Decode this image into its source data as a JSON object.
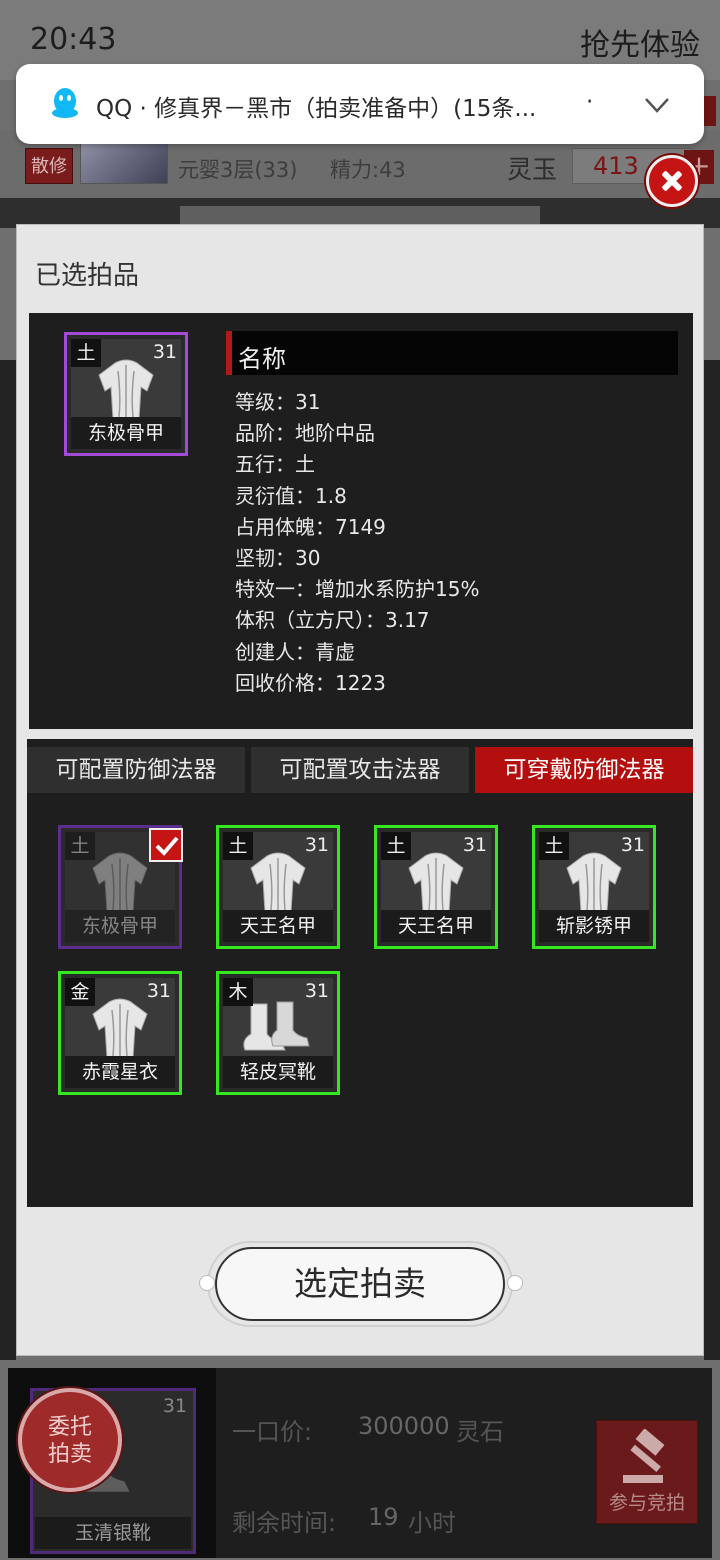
{
  "status_bar": {
    "time": "20:43",
    "right_text": "抢先体验"
  },
  "notification": {
    "app": "QQ",
    "text": "QQ · 修真界－黑市（拍卖准备中）(15条...",
    "dot": "·"
  },
  "background_header": {
    "role": "散修",
    "level": "元婴3层(33)",
    "energy": "精力:43",
    "jade_label": "灵玉",
    "jade_value": "413"
  },
  "modal": {
    "title": "已选拍品",
    "selected_item": {
      "element": "土",
      "level": "31",
      "name": "东极骨甲"
    },
    "name_header": "名称",
    "attributes": [
      "等级：31",
      "品阶：地阶中品",
      "五行：土",
      "灵衍值：1.8",
      "占用体魄：7149",
      "坚韧：30",
      "特效一：增加水系防护15%",
      "体积（立方尺）：3.17",
      "创建人：青虚",
      "回收价格：1223"
    ],
    "tabs": [
      {
        "label": "可配置防御法器",
        "active": false
      },
      {
        "label": "可配置攻击法器",
        "active": false
      },
      {
        "label": "可穿戴防御法器",
        "active": true
      }
    ],
    "items": [
      {
        "element": "土",
        "level": "",
        "name": "东极骨甲",
        "selected": true,
        "icon": "armor-icon"
      },
      {
        "element": "土",
        "level": "31",
        "name": "天王名甲",
        "selected": false,
        "icon": "armor-icon"
      },
      {
        "element": "土",
        "level": "31",
        "name": "天王名甲",
        "selected": false,
        "icon": "armor-icon"
      },
      {
        "element": "土",
        "level": "31",
        "name": "斩影锈甲",
        "selected": false,
        "icon": "armor-icon"
      },
      {
        "element": "金",
        "level": "31",
        "name": "赤霞星衣",
        "selected": false,
        "icon": "armor-icon"
      },
      {
        "element": "木",
        "level": "31",
        "name": "轻皮冥靴",
        "selected": false,
        "icon": "boots-icon"
      }
    ],
    "confirm_label": "选定拍卖"
  },
  "listing": {
    "entrust_label_1": "委托",
    "entrust_label_2": "拍卖",
    "item_level": "31",
    "item_name": "玉清银靴",
    "price_label": "一口价:",
    "price_value": "300000",
    "price_unit": "灵石",
    "time_label": "剩余时间:",
    "time_value": "19",
    "time_unit": "小时",
    "bid_label": "参与竞拍"
  },
  "colors": {
    "accent_red": "#b40f0f",
    "rare_purple": "#a24bd6",
    "available_green": "#35e621"
  }
}
